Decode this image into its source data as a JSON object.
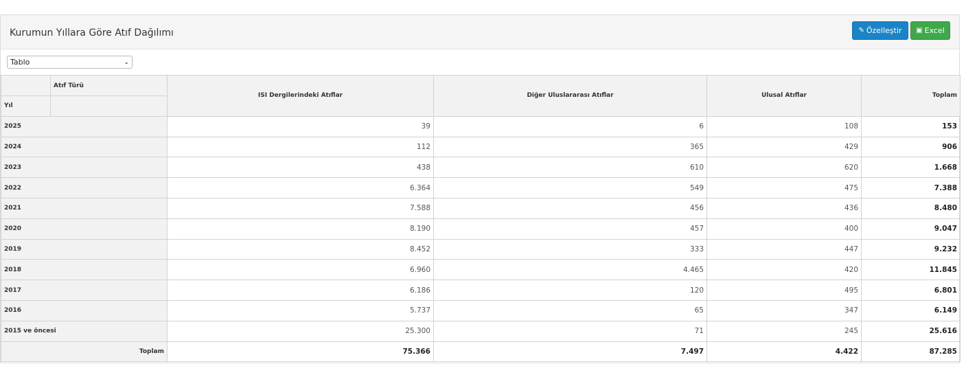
{
  "panel": {
    "title": "Kurumun Yıllara Göre Atıf Dağılımı",
    "customize_label": "Özelleştir",
    "excel_label": "Excel",
    "customize_icon": "edit-icon",
    "excel_icon": "excel-file-icon"
  },
  "view_select": {
    "selected": "Tablo"
  },
  "table": {
    "corner_col_label": "Atıf Türü",
    "corner_row_label": "Yıl",
    "columns": [
      "ISI Dergilerindeki Atıflar",
      "Diğer Uluslararası Atıflar",
      "Ulusal Atıflar",
      "Toplam"
    ],
    "rows": [
      {
        "year": "2025",
        "isi": "39",
        "intl": "6",
        "national": "108",
        "total": "153"
      },
      {
        "year": "2024",
        "isi": "112",
        "intl": "365",
        "national": "429",
        "total": "906"
      },
      {
        "year": "2023",
        "isi": "438",
        "intl": "610",
        "national": "620",
        "total": "1.668"
      },
      {
        "year": "2022",
        "isi": "6.364",
        "intl": "549",
        "national": "475",
        "total": "7.388"
      },
      {
        "year": "2021",
        "isi": "7.588",
        "intl": "456",
        "national": "436",
        "total": "8.480"
      },
      {
        "year": "2020",
        "isi": "8.190",
        "intl": "457",
        "national": "400",
        "total": "9.047"
      },
      {
        "year": "2019",
        "isi": "8.452",
        "intl": "333",
        "national": "447",
        "total": "9.232"
      },
      {
        "year": "2018",
        "isi": "6.960",
        "intl": "4.465",
        "national": "420",
        "total": "11.845"
      },
      {
        "year": "2017",
        "isi": "6.186",
        "intl": "120",
        "national": "495",
        "total": "6.801"
      },
      {
        "year": "2016",
        "isi": "5.737",
        "intl": "65",
        "national": "347",
        "total": "6.149"
      },
      {
        "year": "2015 ve öncesi",
        "isi": "25.300",
        "intl": "71",
        "national": "245",
        "total": "25.616"
      }
    ],
    "footer": {
      "label": "Toplam",
      "isi": "75.366",
      "intl": "7.497",
      "national": "4.422",
      "total": "87.285"
    }
  }
}
